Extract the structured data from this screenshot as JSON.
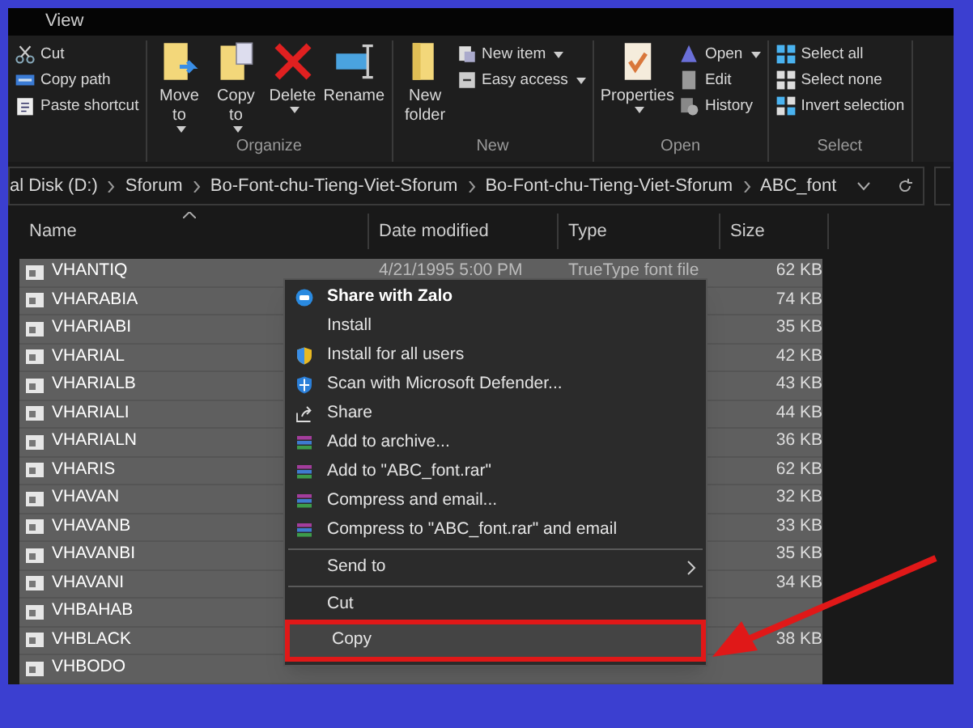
{
  "ribbon_tabs": [
    {
      "label": "View",
      "selected": false
    }
  ],
  "ribbon_groups": [
    {
      "items": [
        {
          "label": "Cut",
          "kind": "small",
          "dropdown": false
        },
        {
          "label": "Copy path",
          "kind": "small",
          "dropdown": false
        },
        {
          "label": "Paste shortcut",
          "kind": "small",
          "dropdown": false
        }
      ]
    },
    {
      "label": "Organize",
      "items": [
        {
          "label": "Move to",
          "kind": "large",
          "dropdown": true
        },
        {
          "label": "Copy to",
          "kind": "large",
          "dropdown": true
        },
        {
          "label": "Delete",
          "kind": "large",
          "dropdown": true
        },
        {
          "label": "Rename",
          "kind": "large",
          "dropdown": false
        }
      ]
    },
    {
      "label": "New",
      "items": [
        {
          "label": "New folder",
          "kind": "large",
          "dropdown": false
        },
        {
          "label": "New item",
          "kind": "small",
          "dropdown": true
        },
        {
          "label": "Easy access",
          "kind": "small",
          "dropdown": true
        }
      ]
    },
    {
      "label": "Open",
      "items": [
        {
          "label": "Properties",
          "kind": "large",
          "dropdown": true
        },
        {
          "label": "Open",
          "kind": "small",
          "dropdown": true
        },
        {
          "label": "Edit",
          "kind": "small",
          "dropdown": false
        },
        {
          "label": "History",
          "kind": "small",
          "dropdown": false
        }
      ]
    },
    {
      "label": "Select",
      "items": [
        {
          "label": "Select all",
          "kind": "small",
          "dropdown": false
        },
        {
          "label": "Select none",
          "kind": "small",
          "dropdown": false
        },
        {
          "label": "Invert selection",
          "kind": "small",
          "dropdown": false
        }
      ]
    }
  ],
  "address": [
    "al Disk (D:)",
    "Sforum",
    "Bo-Font-chu-Tieng-Viet-Sforum",
    "Bo-Font-chu-Tieng-Viet-Sforum",
    "ABC_font"
  ],
  "columns": [
    "Name",
    "Date modified",
    "Type",
    "Size"
  ],
  "files": [
    {
      "name": "VHANTIQ",
      "date": "4/21/1995 5:00 PM",
      "type": "TrueType font file",
      "size": "62 KB",
      "selected": true
    },
    {
      "name": "VHARABIA",
      "size": "74 KB",
      "selected": true
    },
    {
      "name": "VHARIABI",
      "size": "35 KB",
      "selected": true
    },
    {
      "name": "VHARIAL",
      "size": "42 KB",
      "selected": true
    },
    {
      "name": "VHARIALB",
      "size": "43 KB",
      "selected": true
    },
    {
      "name": "VHARIALI",
      "size": "44 KB",
      "selected": true
    },
    {
      "name": "VHARIALN",
      "size": "36 KB",
      "selected": true
    },
    {
      "name": "VHARIS",
      "size": "62 KB",
      "selected": true
    },
    {
      "name": "VHAVAN",
      "size": "32 KB",
      "selected": true
    },
    {
      "name": "VHAVANB",
      "size": "33 KB",
      "selected": true
    },
    {
      "name": "VHAVANBI",
      "size": "35 KB",
      "selected": true
    },
    {
      "name": "VHAVANI",
      "size": "34 KB",
      "selected": true
    },
    {
      "name": "VHBAHAB",
      "selected": true
    },
    {
      "name": "VHBLACK",
      "size": "38 KB",
      "selected": true
    },
    {
      "name": "VHBODO",
      "selected": true
    }
  ],
  "context_menu": [
    {
      "kind": "app",
      "label": "Share with Zalo"
    },
    {
      "kind": "item",
      "label": "Install"
    },
    {
      "kind": "item",
      "label": "Install for all users"
    },
    {
      "kind": "item",
      "label": "Scan with Microsoft Defender..."
    },
    {
      "kind": "item",
      "label": "Share"
    },
    {
      "kind": "item",
      "label": "Add to archive..."
    },
    {
      "kind": "item",
      "label": "Add to \"ABC_font.rar\""
    },
    {
      "kind": "item",
      "label": "Compress and email..."
    },
    {
      "kind": "item",
      "label": "Compress to \"ABC_font.rar\" and email"
    },
    {
      "kind": "separator"
    },
    {
      "kind": "item",
      "label": "Send to",
      "submenu": true
    },
    {
      "kind": "separator"
    },
    {
      "kind": "item",
      "label": "Cut"
    },
    {
      "kind": "item",
      "label": "Copy",
      "highlighted": true
    }
  ]
}
